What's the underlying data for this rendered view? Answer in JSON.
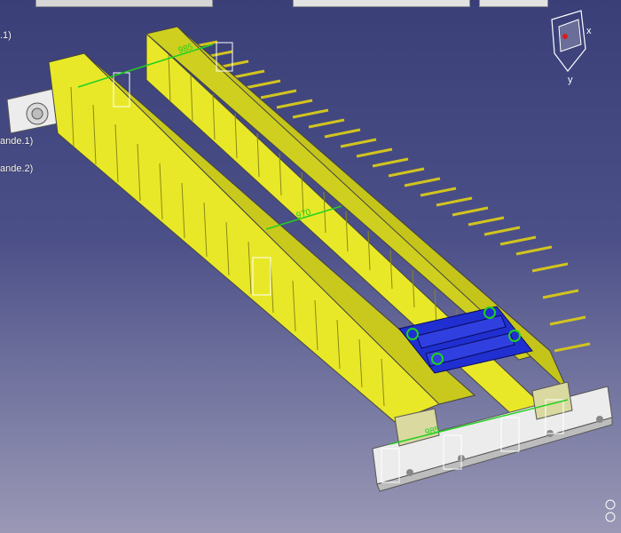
{
  "toolbar": {
    "left_strip": "",
    "middle_strip": "",
    "right_strip": ""
  },
  "tree": {
    "item_top": ".1)",
    "item_1": "ande.1)",
    "item_2": "ande.2)"
  },
  "dimensions": {
    "top": "985",
    "center": "970",
    "bottom": "985"
  },
  "compass": {
    "x_label": "x",
    "y_label": "y"
  },
  "colors": {
    "beam": "#e8e829",
    "beam_dark": "#b9b91c",
    "trolley": "#1f2fd0",
    "dimension": "#20d020",
    "end_carriage": "#f0f0f0"
  }
}
